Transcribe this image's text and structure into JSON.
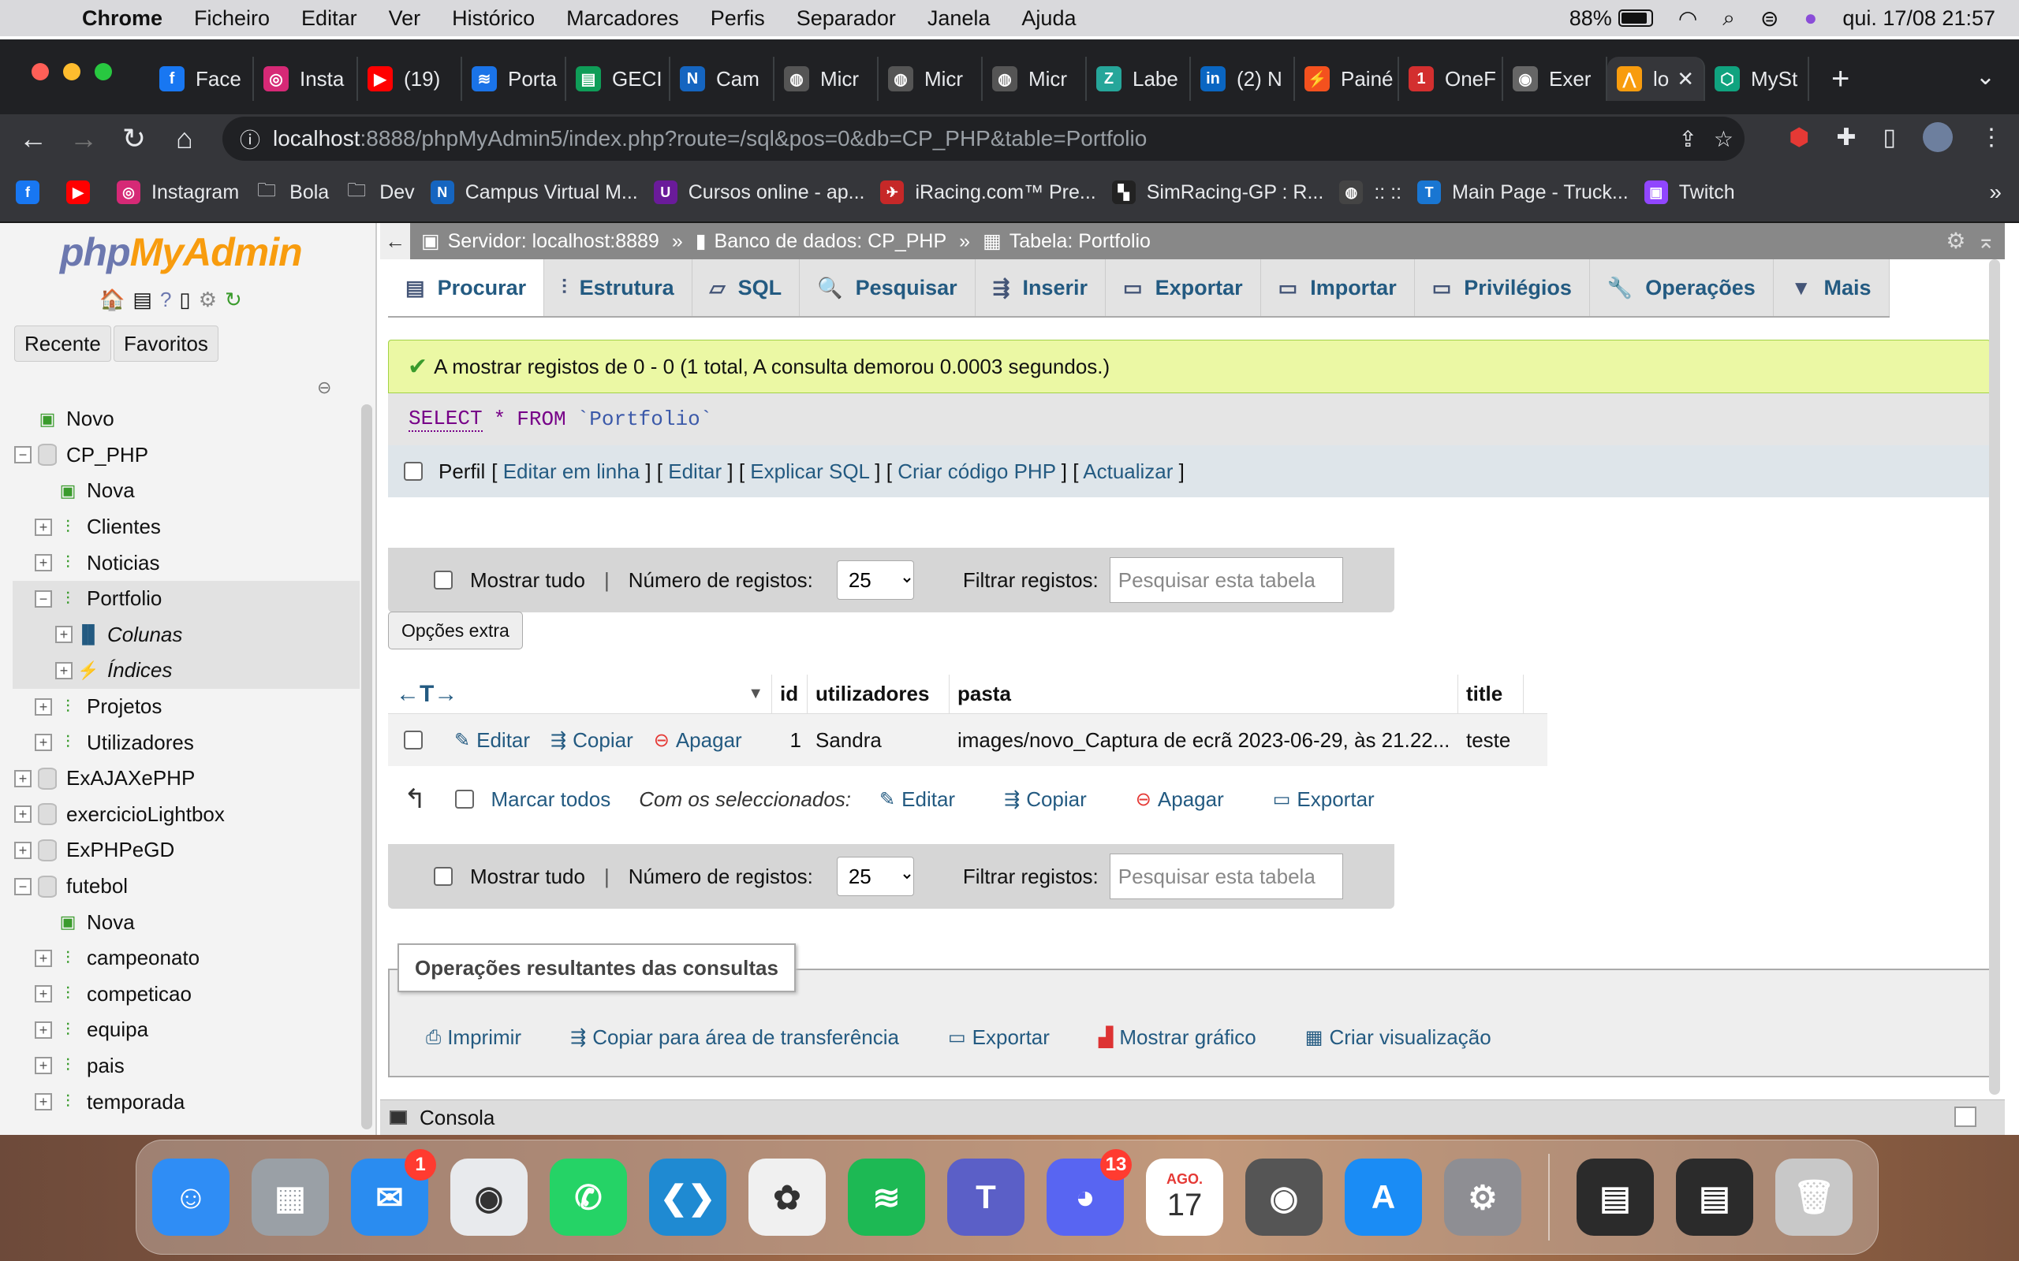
{
  "menubar": {
    "app": "Chrome",
    "items": [
      "Ficheiro",
      "Editar",
      "Ver",
      "Histórico",
      "Marcadores",
      "Perfis",
      "Separador",
      "Janela",
      "Ajuda"
    ],
    "battery": "88%",
    "datetime": "qui. 17/08  21:57"
  },
  "tabs": [
    {
      "label": "Face",
      "color": "#1877f2",
      "glyph": "f"
    },
    {
      "label": "Insta",
      "color": "#d62976",
      "glyph": "◎"
    },
    {
      "label": "(19)",
      "color": "#ff0000",
      "glyph": "▶"
    },
    {
      "label": "Porta",
      "color": "#1a73e8",
      "glyph": "≋"
    },
    {
      "label": "GECI",
      "color": "#0f9d58",
      "glyph": "▤"
    },
    {
      "label": "Cam",
      "color": "#1565c0",
      "glyph": "N"
    },
    {
      "label": "Micr",
      "color": "#555",
      "glyph": "◍"
    },
    {
      "label": "Micr",
      "color": "#555",
      "glyph": "◍"
    },
    {
      "label": "Micr",
      "color": "#555",
      "glyph": "◍"
    },
    {
      "label": "Labe",
      "color": "#26a69a",
      "glyph": "Z"
    },
    {
      "label": "(2) N",
      "color": "#0a66c2",
      "glyph": "in"
    },
    {
      "label": "Painé",
      "color": "#f4511e",
      "glyph": "⚡"
    },
    {
      "label": "OneF",
      "color": "#d32f2f",
      "glyph": "1"
    },
    {
      "label": "Exer",
      "color": "#666",
      "glyph": "◉"
    },
    {
      "label": "lo",
      "color": "#f89c0e",
      "glyph": "⋀",
      "active": true
    },
    {
      "label": "MySt",
      "color": "#10a37f",
      "glyph": "⬡"
    }
  ],
  "address": {
    "host": "localhost",
    "rest": ":8888/phpMyAdmin5/index.php?route=/sql&pos=0&db=CP_PHP&table=Portfolio"
  },
  "bookmarks": [
    {
      "label": "",
      "color": "#1877f2",
      "glyph": "f"
    },
    {
      "label": "",
      "color": "#ff0000",
      "glyph": "▶"
    },
    {
      "label": "Instagram",
      "color": "#d62976",
      "glyph": "◎"
    },
    {
      "label": "Bola",
      "color": "transparent",
      "glyph": "🗀"
    },
    {
      "label": "Dev",
      "color": "transparent",
      "glyph": "🗀"
    },
    {
      "label": "Campus Virtual M...",
      "color": "#1565c0",
      "glyph": "N"
    },
    {
      "label": "Cursos online - ap...",
      "color": "#6a1b9a",
      "glyph": "U"
    },
    {
      "label": "iRacing.com™ Pre...",
      "color": "#c62828",
      "glyph": "✈"
    },
    {
      "label": "SimRacing-GP : R...",
      "color": "#222",
      "glyph": "▚"
    },
    {
      "label": ":: ::",
      "color": "#444",
      "glyph": "◍"
    },
    {
      "label": "Main Page - Truck...",
      "color": "#1976d2",
      "glyph": "T"
    },
    {
      "label": "Twitch",
      "color": "#9146ff",
      "glyph": "▣"
    }
  ],
  "pma": {
    "logo_php": "php",
    "logo_ma": "MyAdmin",
    "recent": "Recente",
    "favorites": "Favoritos",
    "tree": [
      {
        "label": "Novo",
        "depth": 0,
        "exp": "",
        "icon": "new"
      },
      {
        "label": "CP_PHP",
        "depth": 0,
        "exp": "−",
        "icon": "db"
      },
      {
        "label": "Nova",
        "depth": 1,
        "exp": "",
        "icon": "new"
      },
      {
        "label": "Clientes",
        "depth": 1,
        "exp": "+",
        "icon": "table"
      },
      {
        "label": "Noticias",
        "depth": 1,
        "exp": "+",
        "icon": "table"
      },
      {
        "label": "Portfolio",
        "depth": 1,
        "exp": "−",
        "icon": "table",
        "hl": true
      },
      {
        "label": "Colunas",
        "depth": 2,
        "exp": "+",
        "icon": "cols",
        "italic": true,
        "hl": true
      },
      {
        "label": "Índices",
        "depth": 2,
        "exp": "+",
        "icon": "idx",
        "italic": true,
        "hl": true
      },
      {
        "label": "Projetos",
        "depth": 1,
        "exp": "+",
        "icon": "table"
      },
      {
        "label": "Utilizadores",
        "depth": 1,
        "exp": "+",
        "icon": "table"
      },
      {
        "label": "ExAJAXePHP",
        "depth": 0,
        "exp": "+",
        "icon": "db"
      },
      {
        "label": "exercicioLightbox",
        "depth": 0,
        "exp": "+",
        "icon": "db"
      },
      {
        "label": "ExPHPeGD",
        "depth": 0,
        "exp": "+",
        "icon": "db"
      },
      {
        "label": "futebol",
        "depth": 0,
        "exp": "−",
        "icon": "db"
      },
      {
        "label": "Nova",
        "depth": 1,
        "exp": "",
        "icon": "new"
      },
      {
        "label": "campeonato",
        "depth": 1,
        "exp": "+",
        "icon": "table"
      },
      {
        "label": "competicao",
        "depth": 1,
        "exp": "+",
        "icon": "table"
      },
      {
        "label": "equipa",
        "depth": 1,
        "exp": "+",
        "icon": "table"
      },
      {
        "label": "pais",
        "depth": 1,
        "exp": "+",
        "icon": "table"
      },
      {
        "label": "temporada",
        "depth": 1,
        "exp": "+",
        "icon": "table"
      }
    ],
    "breadcrumb": {
      "server": "Servidor: localhost:8889",
      "db": "Banco de dados: CP_PHP",
      "table": "Tabela: Portfolio"
    },
    "tabs": [
      {
        "label": "Procurar",
        "icon": "▤",
        "active": true
      },
      {
        "label": "Estrutura",
        "icon": "⫶"
      },
      {
        "label": "SQL",
        "icon": "▱"
      },
      {
        "label": "Pesquisar",
        "icon": "🔍"
      },
      {
        "label": "Inserir",
        "icon": "⇶"
      },
      {
        "label": "Exportar",
        "icon": "▭"
      },
      {
        "label": "Importar",
        "icon": "▭"
      },
      {
        "label": "Privilégios",
        "icon": "▭"
      },
      {
        "label": "Operações",
        "icon": "🔧"
      },
      {
        "label": "Mais",
        "icon": "▼"
      }
    ],
    "message": "A mostrar registos de 0 - 0 (1 total, A consulta demorou 0.0003 segundos.)",
    "sql": {
      "select": "SELECT",
      "star": "*",
      "from": "FROM",
      "table": "`Portfolio`"
    },
    "profile": {
      "label": "Perfil",
      "links": [
        "Editar em linha",
        "Editar",
        "Explicar SQL",
        "Criar código PHP",
        "Actualizar"
      ]
    },
    "nav": {
      "show_all": "Mostrar tudo",
      "num_records": "Número de registos:",
      "num_value": "25",
      "filter": "Filtrar registos:",
      "filter_placeholder": "Pesquisar esta tabela"
    },
    "extra_options": "Opções extra",
    "columns": [
      "id",
      "utilizadores",
      "pasta",
      "title"
    ],
    "rows": [
      {
        "id": "1",
        "utilizadores": "Sandra",
        "pasta": "images/novo_Captura de ecrã 2023-06-29, às 21.22...",
        "title": "teste"
      }
    ],
    "row_actions": [
      "Editar",
      "Copiar",
      "Apagar"
    ],
    "with_selected": {
      "check_all": "Marcar todos",
      "label": "Com os seleccionados:",
      "actions": [
        "Editar",
        "Copiar",
        "Apagar",
        "Exportar"
      ]
    },
    "query_ops": {
      "legend": "Operações resultantes das consultas",
      "actions": [
        "Imprimir",
        "Copiar para área de transferência",
        "Exportar",
        "Mostrar gráfico",
        "Criar visualização"
      ]
    },
    "console": "Consola"
  },
  "dock": [
    {
      "name": "finder",
      "color": "#2f8df5",
      "glyph": "☺"
    },
    {
      "name": "launchpad",
      "color": "#9aa0a6",
      "glyph": "▦"
    },
    {
      "name": "mail",
      "color": "#2a8cf0",
      "glyph": "✉",
      "badge": "1"
    },
    {
      "name": "chrome",
      "color": "#e8eaed",
      "glyph": "◉"
    },
    {
      "name": "whatsapp",
      "color": "#25d366",
      "glyph": "✆"
    },
    {
      "name": "vscode",
      "color": "#1f8ad2",
      "glyph": "❮❯"
    },
    {
      "name": "photos",
      "color": "#f0f0f0",
      "glyph": "✿"
    },
    {
      "name": "spotify",
      "color": "#1db954",
      "glyph": "≋"
    },
    {
      "name": "teams",
      "color": "#5b5fc7",
      "glyph": "T"
    },
    {
      "name": "discord",
      "color": "#5865f2",
      "glyph": "◕",
      "badge": "13"
    },
    {
      "name": "calendar",
      "color": "#ffffff",
      "glyph": "17",
      "month": "AGO."
    },
    {
      "name": "mamp",
      "color": "#555",
      "glyph": "◉"
    },
    {
      "name": "app-store",
      "color": "#1a8cf5",
      "glyph": "A"
    },
    {
      "name": "system-settings",
      "color": "#8e8e93",
      "glyph": "⚙"
    },
    {
      "name": "recent-1",
      "color": "#2b2b2b",
      "glyph": "▤"
    },
    {
      "name": "recent-2",
      "color": "#2b2b2b",
      "glyph": "▤"
    },
    {
      "name": "trash",
      "color": "#c8c8c8",
      "glyph": "🗑"
    }
  ]
}
